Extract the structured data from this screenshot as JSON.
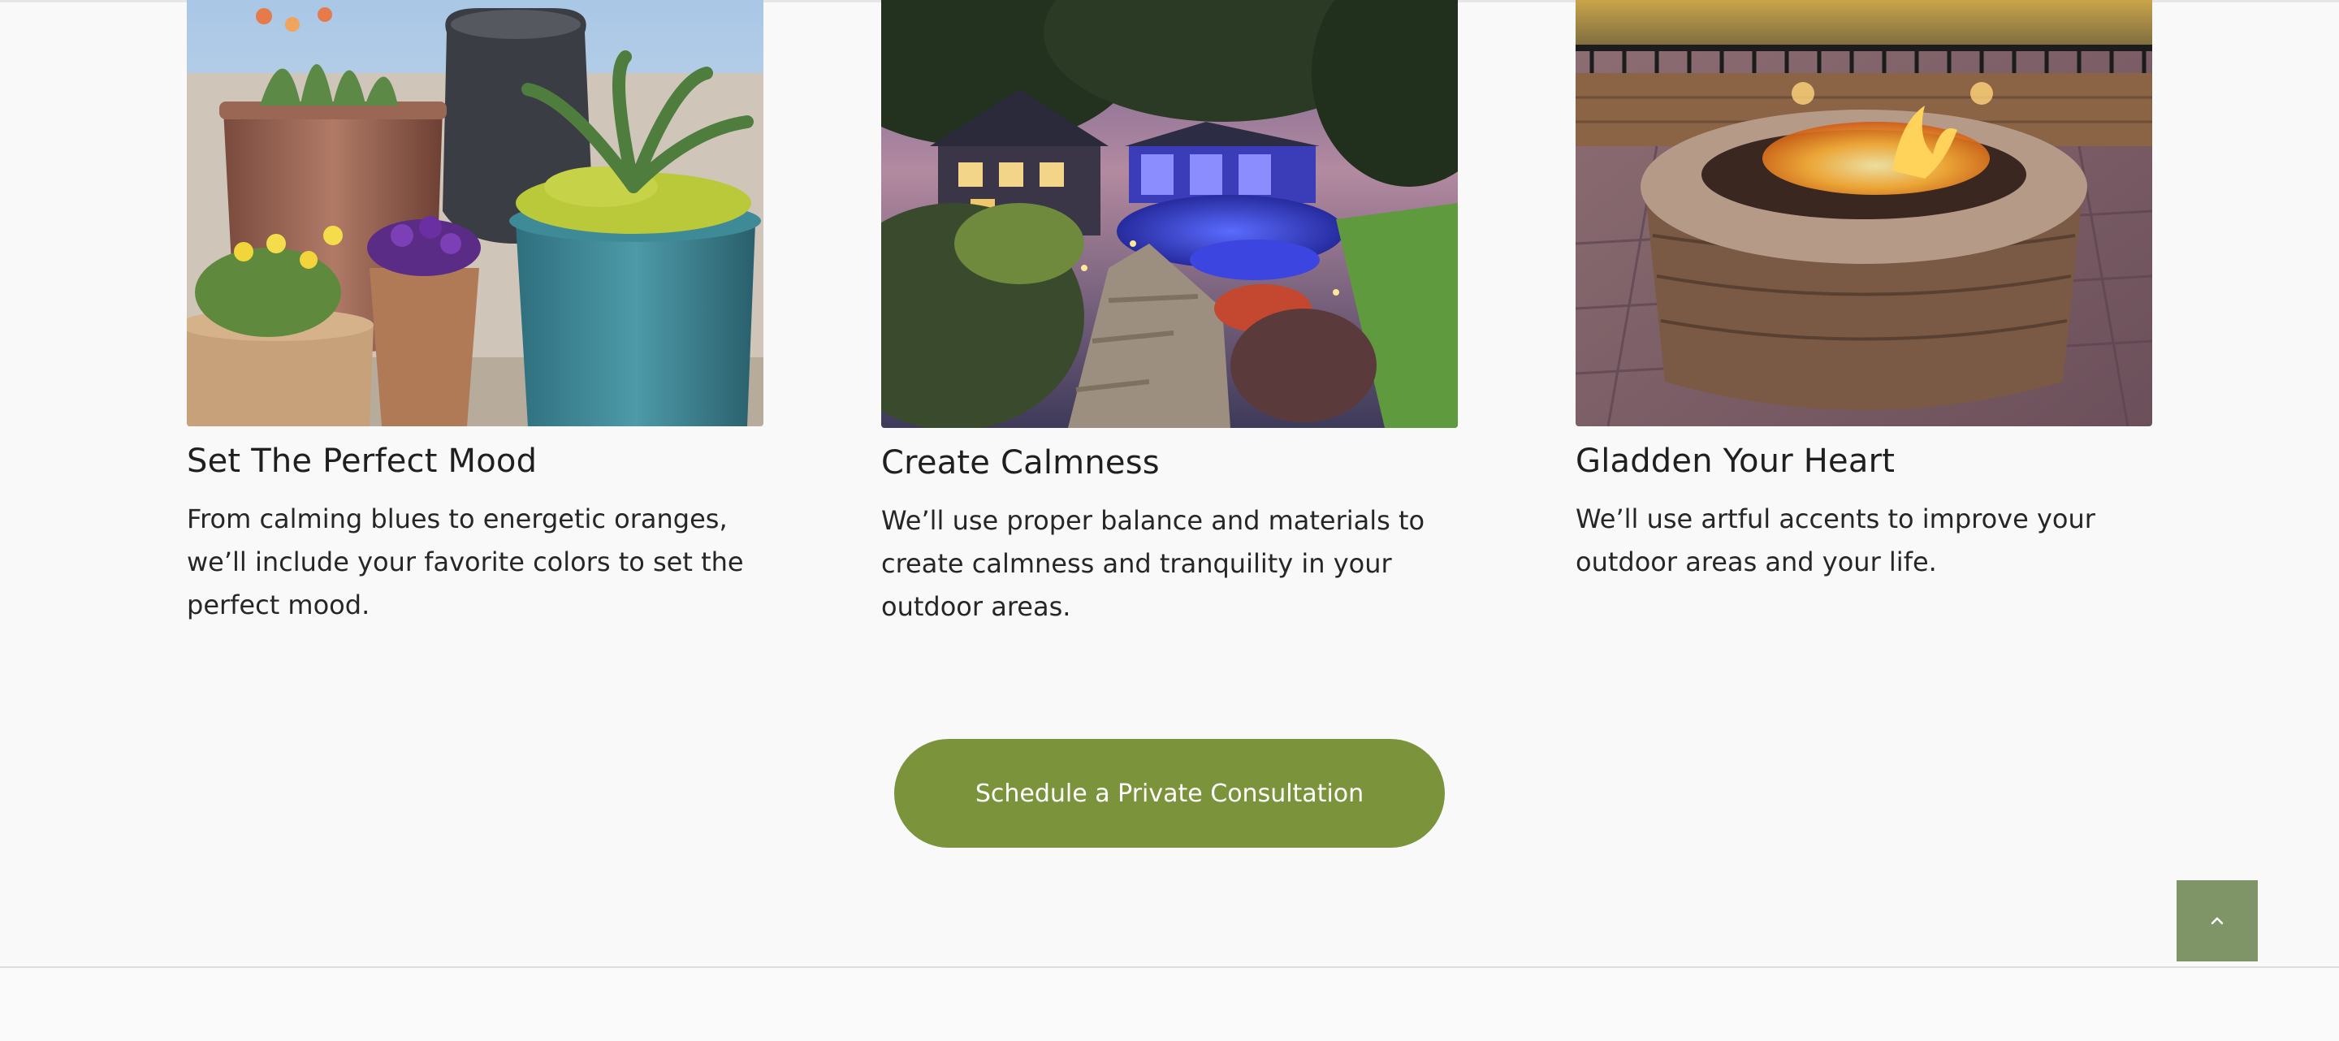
{
  "cards": [
    {
      "title": "Set The Perfect Mood",
      "text": "From calming blues to energetic oranges, we’ll include your favorite colors to set the perfect mood.",
      "image": "potted-plants-photo"
    },
    {
      "title": "Create Calmness",
      "text": "We’ll use proper balance and materials to create calmness and tranquility in your outdoor areas.",
      "image": "illuminated-pool-garden-photo"
    },
    {
      "title": "Gladden Your Heart",
      "text": "We’ll use artful accents to improve your outdoor areas and your life.",
      "image": "stone-fire-pit-photo"
    }
  ],
  "cta": {
    "label": "Schedule a Private Consultation"
  },
  "scroll_top": {
    "icon": "chevron-up-icon"
  },
  "colors": {
    "accent": "#7b943c",
    "scroll_top_bg": "#7f9567",
    "page_bg": "#f9f9f9"
  }
}
